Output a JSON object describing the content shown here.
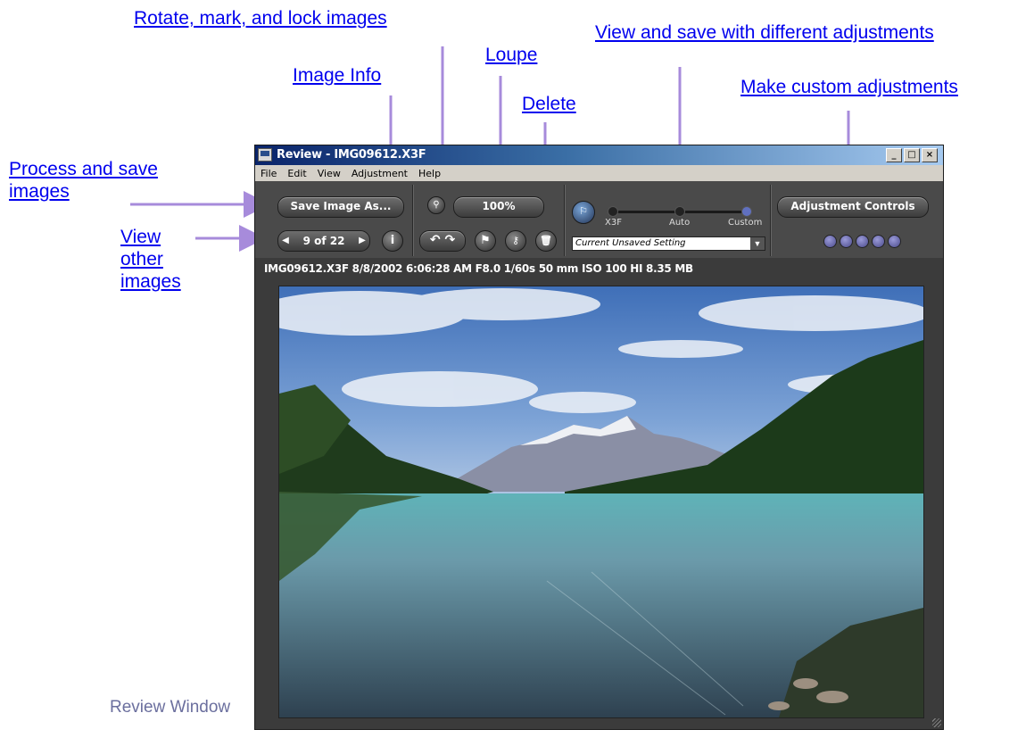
{
  "callouts": {
    "rotate_mark_lock": "Rotate, mark, and lock images",
    "view_save": "View and save with different adjustments",
    "loupe": "Loupe",
    "image_info": "Image Info",
    "make_custom": "Make custom adjustments",
    "delete": "Delete",
    "process_save": "Process and save images",
    "view_other": "View other images"
  },
  "caption": "Review Window",
  "window": {
    "title": "Review - IMG09612.X3F",
    "buttons": {
      "minimize": "_",
      "maximize": "□",
      "close": "×"
    },
    "menu": [
      "File",
      "Edit",
      "View",
      "Adjustment",
      "Help"
    ]
  },
  "toolbar": {
    "save_label": "Save Image As...",
    "nav_label": "9 of 22",
    "nav_prev": "◀",
    "nav_next": "▶",
    "info_label": "i",
    "zoom_value": "100%",
    "slider_labels": {
      "x3f": "X3F",
      "auto": "Auto",
      "custom": "Custom"
    },
    "slider_position": "Custom",
    "setting_selected": "Current Unsaved Setting",
    "adjust_label": "Adjustment Controls",
    "adjust_slots": 5
  },
  "info_bar": "IMG09612.X3F  8/8/2002  6:06:28 AM  F8.0  1/60s  50 mm  ISO 100  HI  8.35 MB",
  "icons": {
    "zoom": "magnifier-icon",
    "rotate_left": "rotate-left-icon",
    "rotate_right": "rotate-right-icon",
    "flag": "flag-icon",
    "lock": "key-icon",
    "delete": "trash-icon",
    "x3f": "x3f-mode-icon"
  },
  "colors": {
    "link": "#0000ee",
    "arrow": "#a78bdb",
    "window_bg": "#3b3b3b",
    "caption": "#6b6f9e"
  }
}
